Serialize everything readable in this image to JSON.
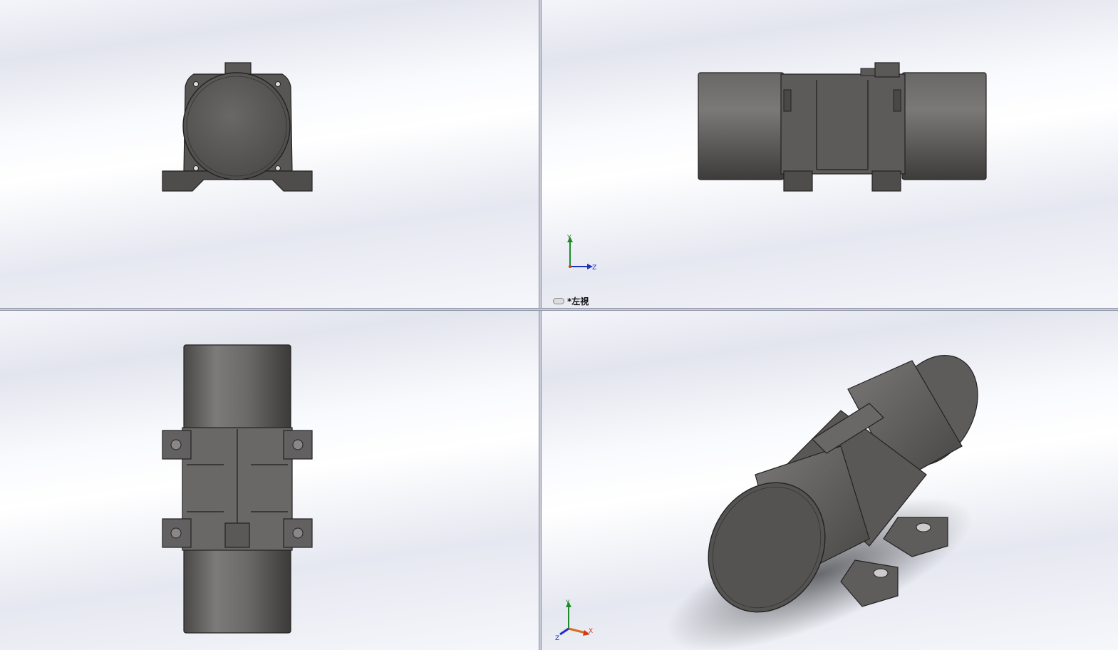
{
  "viewports": [
    {
      "id": "top-left",
      "orientation": "front"
    },
    {
      "id": "top-right",
      "orientation": "left",
      "label": "*左視"
    },
    {
      "id": "bottom-left",
      "orientation": "top"
    },
    {
      "id": "bottom-right",
      "orientation": "isometric"
    }
  ],
  "triad_top_right": {
    "axis_y": "Y",
    "axis_z": "Z"
  },
  "triad_bottom_right": {
    "axis_y": "Y",
    "axis_x": "X",
    "axis_z": "Z"
  },
  "colors": {
    "model_body": "#5a5856",
    "model_edge": "#222222",
    "axis_x": "#d03a10",
    "axis_y": "#1f8a2a",
    "axis_z": "#2030c0"
  }
}
